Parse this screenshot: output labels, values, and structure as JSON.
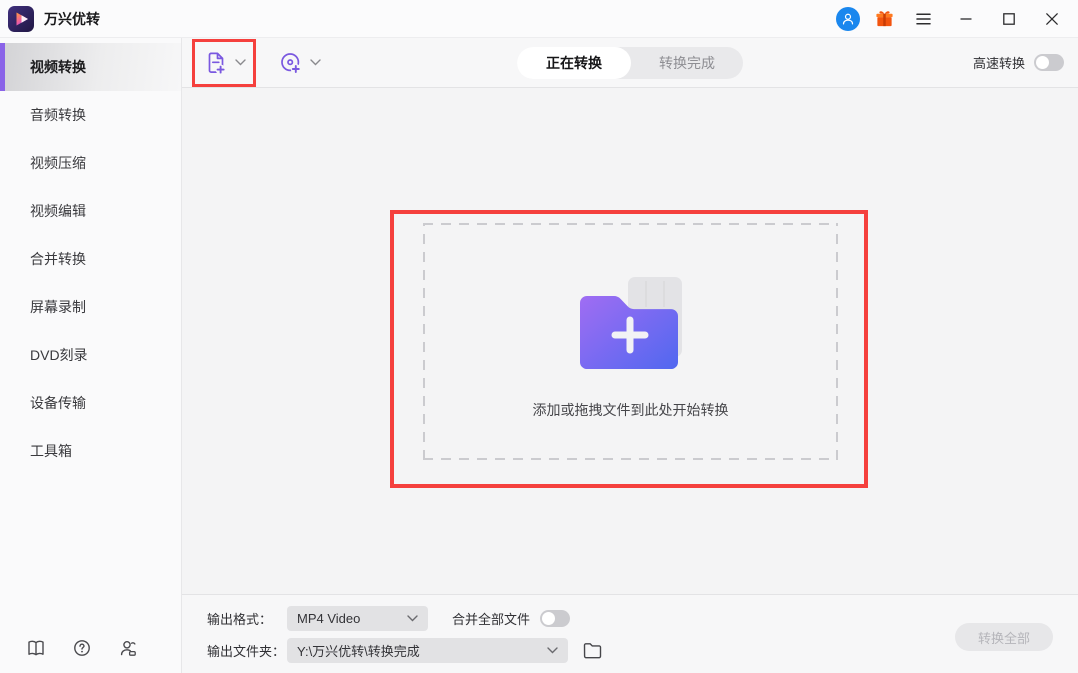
{
  "titlebar": {
    "app_title": "万兴优转"
  },
  "sidebar": {
    "items": [
      {
        "label": "视频转换",
        "active": true
      },
      {
        "label": "音频转换",
        "active": false
      },
      {
        "label": "视频压缩",
        "active": false
      },
      {
        "label": "视频编辑",
        "active": false
      },
      {
        "label": "合并转换",
        "active": false
      },
      {
        "label": "屏幕录制",
        "active": false
      },
      {
        "label": "DVD刻录",
        "active": false
      },
      {
        "label": "设备传输",
        "active": false
      },
      {
        "label": "工具箱",
        "active": false
      }
    ]
  },
  "toolbar": {
    "tabs": [
      {
        "label": "正在转换",
        "active": true
      },
      {
        "label": "转换完成",
        "active": false
      }
    ],
    "fast_convert_label": "高速转换",
    "fast_convert_on": false
  },
  "dropzone": {
    "hint": "添加或拖拽文件到此处开始转换"
  },
  "bottombar": {
    "output_format_label": "输出格式：",
    "output_format_value": "MP4 Video",
    "merge_all_label": "合并全部文件",
    "merge_all_on": false,
    "output_folder_label": "输出文件夹：",
    "output_folder_value": "Y:\\万兴优转\\转换完成",
    "convert_all_label": "转换全部",
    "convert_all_enabled": false
  },
  "colors": {
    "accent_purple": "#7b5ce5",
    "annotation_red": "#f5403d",
    "avatar_blue": "#1a87ee",
    "gift_orange": "#f2540f"
  },
  "icons": [
    "app-logo-icon",
    "user-avatar-icon",
    "gift-icon",
    "hamburger-menu-icon",
    "minimize-icon",
    "maximize-icon",
    "close-icon",
    "add-file-icon",
    "add-dvd-icon",
    "chevron-down-icon",
    "folder-plus-graphic",
    "book-icon",
    "help-icon",
    "contact-icon",
    "browse-folder-icon",
    "toggle-switch"
  ]
}
